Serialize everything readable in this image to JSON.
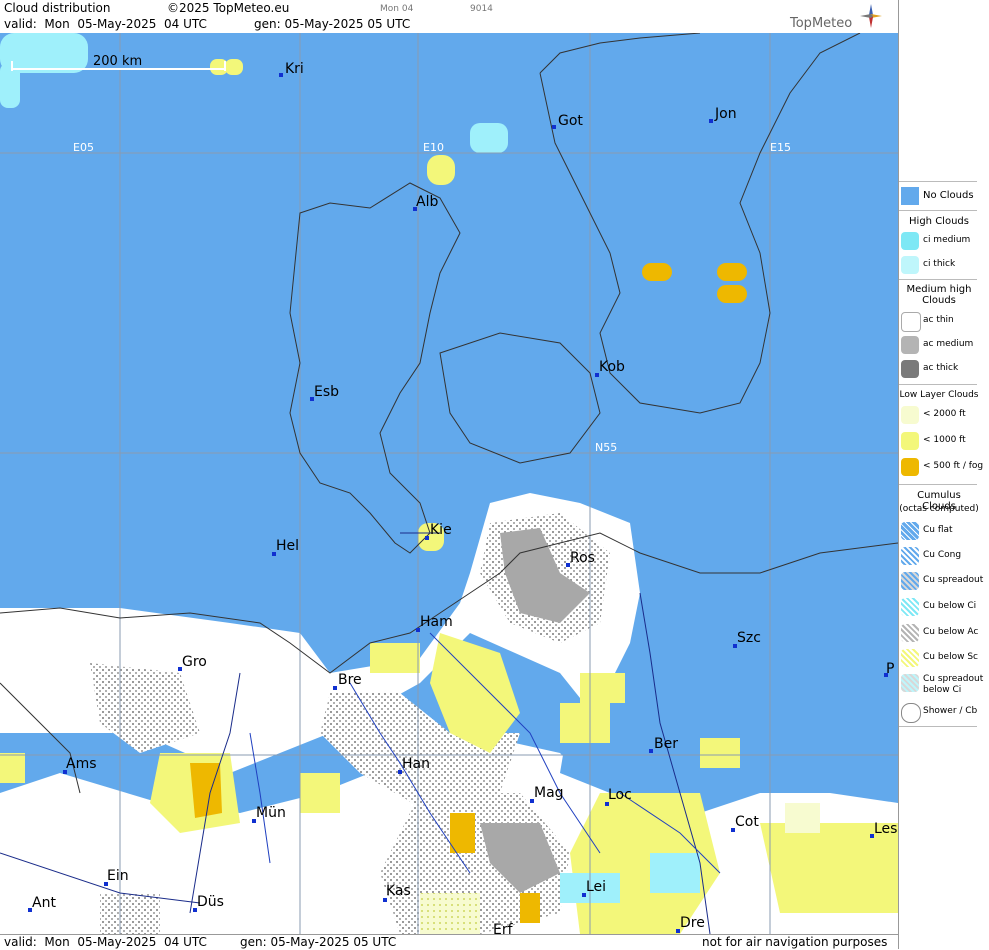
{
  "header": {
    "title": "Cloud distribution",
    "copyright": "©2025 TopMeteo.eu",
    "valid_label": "valid:  Mon  05-May-2025  04 UTC",
    "gen_label": "gen: 05-May-2025 05 UTC",
    "mid_small_1": "Mon 04",
    "mid_small_2": "9014",
    "logo_text": "TopMeteo"
  },
  "footer": {
    "valid_label": "valid:  Mon  05-May-2025  04 UTC",
    "gen_label": "gen: 05-May-2025 05 UTC",
    "disclaimer": "not for air navigation purposes"
  },
  "map": {
    "scale_label": "200 km",
    "grid_labels": [
      "E05",
      "E10",
      "E15",
      "N55"
    ],
    "cities": [
      {
        "name": "Kri"
      },
      {
        "name": "Got"
      },
      {
        "name": "Jon"
      },
      {
        "name": "Alb"
      },
      {
        "name": "Esb"
      },
      {
        "name": "Kob"
      },
      {
        "name": "Kie"
      },
      {
        "name": "Ros"
      },
      {
        "name": "Hel"
      },
      {
        "name": "Ham"
      },
      {
        "name": "Szc"
      },
      {
        "name": "Gro"
      },
      {
        "name": "Bre"
      },
      {
        "name": "P"
      },
      {
        "name": "Ams"
      },
      {
        "name": "Han"
      },
      {
        "name": "Ber"
      },
      {
        "name": "Mag"
      },
      {
        "name": "Loc"
      },
      {
        "name": "Mün"
      },
      {
        "name": "Cot"
      },
      {
        "name": "Les"
      },
      {
        "name": "Ein"
      },
      {
        "name": "Lei"
      },
      {
        "name": "Kas"
      },
      {
        "name": "Ant"
      },
      {
        "name": "Düs"
      },
      {
        "name": "Dre"
      },
      {
        "name": "Erf"
      }
    ]
  },
  "legend": {
    "no_clouds": "No Clouds",
    "high_title": "High Clouds",
    "high": [
      "ci medium",
      "ci thick"
    ],
    "medium_title": "Medium high Clouds",
    "medium": [
      "ac thin",
      "ac medium",
      "ac thick"
    ],
    "low_title": "Low Layer Clouds",
    "low": [
      "< 2000 ft",
      "< 1000 ft",
      "< 500 ft / fog"
    ],
    "cu_title": "Cumulus Clouds",
    "cu_subtitle": "(octas computed)",
    "cu": [
      "Cu flat",
      "Cu Cong",
      "Cu spreadout",
      "Cu below Ci",
      "Cu below Ac",
      "Cu below Sc",
      "Cu spreadout below Ci",
      "Shower / Cb"
    ],
    "colors": {
      "no_clouds": "#62a9ec",
      "ci_medium": "#7ee8f5",
      "ci_thick": "#bff6fb",
      "ac_thin": "#ffffff",
      "ac_medium": "#b4b4b4",
      "ac_thick": "#7a7a7a",
      "low_2000": "#f7fbd0",
      "low_1000": "#f3f77a",
      "low_500": "#eeb800"
    }
  }
}
